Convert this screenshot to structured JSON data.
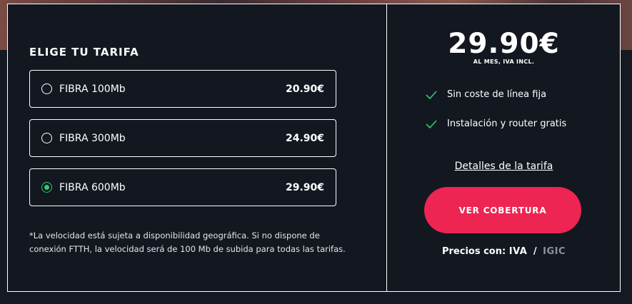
{
  "tariff": {
    "title": "ELIGE TU TARIFA",
    "plans": [
      {
        "name": "FIBRA 100Mb",
        "price": "20.90€",
        "selected": false
      },
      {
        "name": "FIBRA 300Mb",
        "price": "24.90€",
        "selected": false
      },
      {
        "name": "FIBRA 600Mb",
        "price": "29.90€",
        "selected": true
      }
    ],
    "footnote": "*La velocidad está sujeta a disponibilidad geográfica. Si no dispone de conexión FTTH, la velocidad será de 100 Mb de subida para todas las tarifas."
  },
  "summary": {
    "price": "29.90€",
    "price_note": "AL MES, IVA INCL.",
    "features": [
      {
        "icon": "check-icon",
        "text": "Sin coste de línea fija"
      },
      {
        "icon": "check-icon",
        "text": "Instalación y router gratis"
      }
    ],
    "details_link": "Detalles de la tarifa",
    "cta_label": "VER COBERTURA",
    "tax": {
      "label": "Precios con:",
      "option_iva": "IVA",
      "separator": "/",
      "option_igic": "IGIC"
    }
  },
  "colors": {
    "accent": "#ee2453",
    "selected": "#2ecc71",
    "background": "#121720"
  }
}
